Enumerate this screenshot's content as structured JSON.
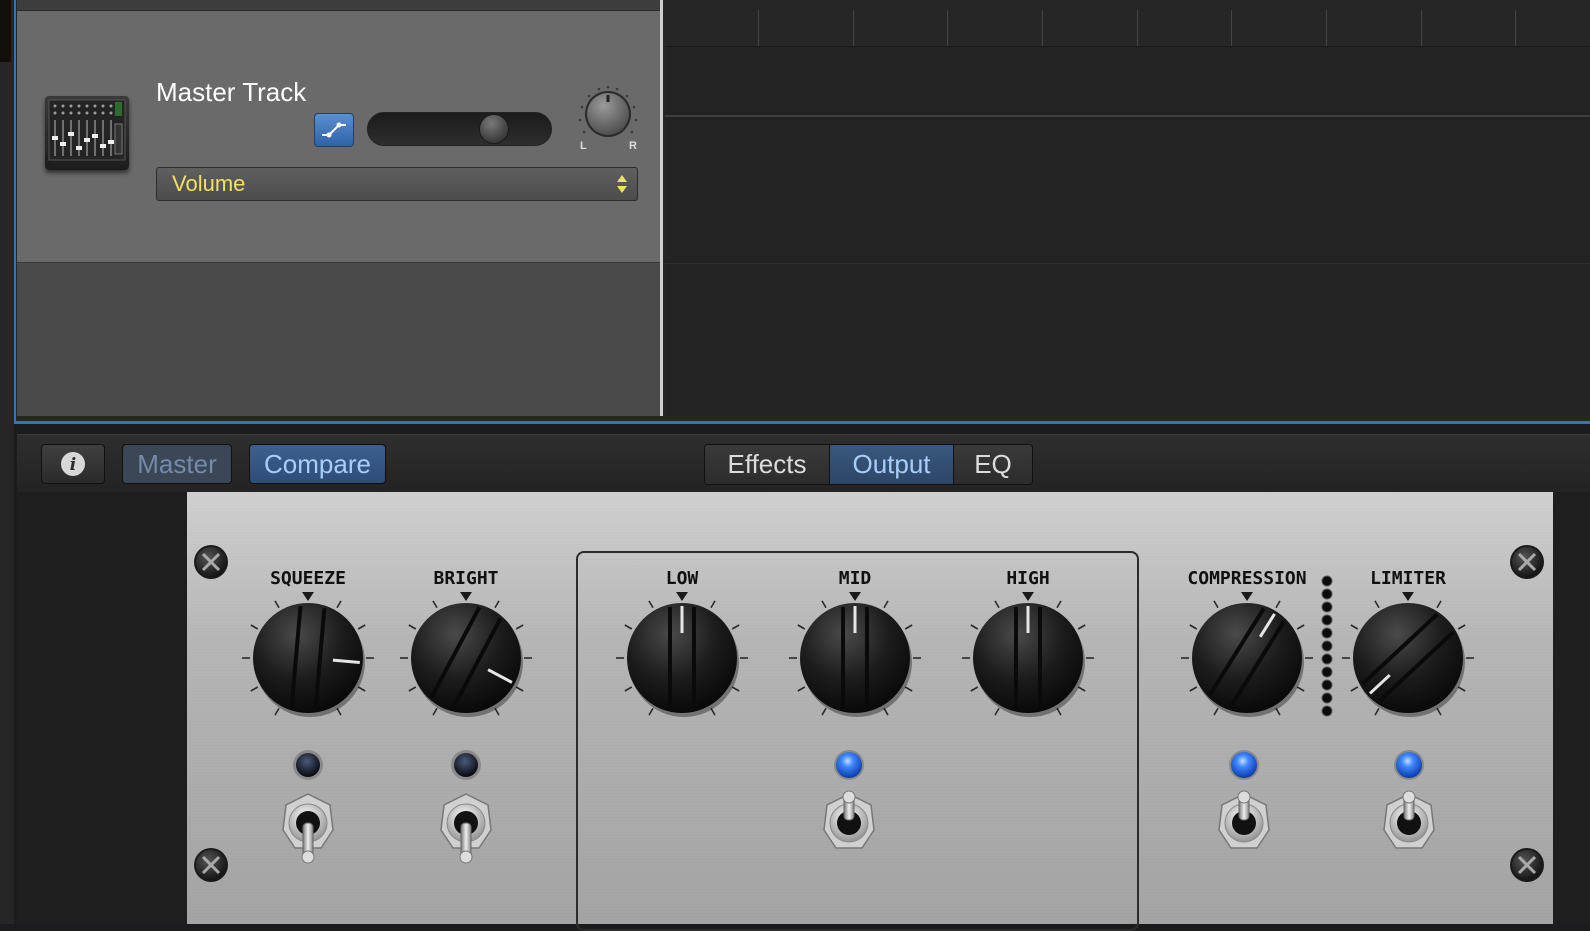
{
  "track": {
    "name": "Master Track",
    "pan_left": "L",
    "pan_right": "R",
    "parameter": "Volume",
    "automation_enabled": true,
    "volume_level": 0.7
  },
  "toolbar": {
    "info_label": "i",
    "master_label": "Master",
    "compare_label": "Compare",
    "tabs": [
      {
        "label": "Effects",
        "selected": false
      },
      {
        "label": "Output",
        "selected": true
      },
      {
        "label": "EQ",
        "selected": false
      }
    ]
  },
  "controls": [
    {
      "label": "SQUEEZE",
      "led_on": false,
      "toggle": "down"
    },
    {
      "label": "BRIGHT",
      "led_on": false,
      "toggle": "down"
    },
    {
      "label": "LOW"
    },
    {
      "label": "MID",
      "led_on": true,
      "toggle": "up"
    },
    {
      "label": "HIGH"
    },
    {
      "label": "COMPRESSION",
      "led_on": true,
      "toggle": "up"
    },
    {
      "label": "LIMITER",
      "led_on": true,
      "toggle": "up"
    }
  ],
  "colors": {
    "accent": "#3b72b6",
    "param_text": "#f2e060",
    "led_on": "#2f6cf0",
    "tab_selected_text": "#a9cdfa"
  }
}
